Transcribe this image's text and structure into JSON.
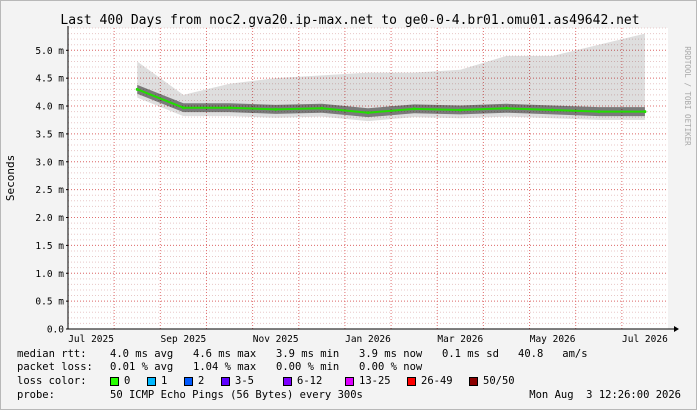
{
  "chart_data": {
    "type": "area",
    "title": "Last 400 Days from noc2.gva20.ip-max.net to ge0-0-4.br01.omu01.as49642.net",
    "ylabel": "Seconds",
    "side_label": "RRDTOOL / TOBI OETIKER",
    "ylim": [
      0,
      5.4
    ],
    "y_ticks": [
      {
        "value": 0.0,
        "label": "0.0"
      },
      {
        "value": 0.5,
        "label": "0.5 m"
      },
      {
        "value": 1.0,
        "label": "1.0 m"
      },
      {
        "value": 1.5,
        "label": "1.5 m"
      },
      {
        "value": 2.0,
        "label": "2.0 m"
      },
      {
        "value": 2.5,
        "label": "2.5 m"
      },
      {
        "value": 3.0,
        "label": "3.0 m"
      },
      {
        "value": 3.5,
        "label": "3.5 m"
      },
      {
        "value": 4.0,
        "label": "4.0 m"
      },
      {
        "value": 4.5,
        "label": "4.5 m"
      },
      {
        "value": 5.0,
        "label": "5.0 m"
      }
    ],
    "x_ticks": [
      "Jul 2025",
      "Sep 2025",
      "Nov 2025",
      "Jan 2026",
      "Mar 2026",
      "May 2026",
      "Jul 2026"
    ],
    "x": [
      "Jul 2025",
      "Aug 2025",
      "Sep 2025",
      "Oct 2025",
      "Nov 2025",
      "Dec 2025",
      "Jan 2026",
      "Feb 2026",
      "Mar 2026",
      "Apr 2026",
      "May 2026",
      "Jun 2026",
      "Jul 2026"
    ],
    "series": [
      {
        "name": "median rtt",
        "values": [
          null,
          4.3,
          3.97,
          3.97,
          3.94,
          3.96,
          3.88,
          3.95,
          3.93,
          3.96,
          3.93,
          3.9,
          3.9
        ]
      },
      {
        "name": "",
        "values": [
          null,
          4.8,
          4.2,
          4.4,
          4.5,
          4.55,
          4.6,
          4.6,
          4.65,
          4.9,
          4.9,
          5.1,
          5.3
        ]
      }
    ]
  },
  "stats": {
    "median_rtt": {
      "label": "median rtt:",
      "avg": "4.0 ms avg",
      "max": "4.6 ms max",
      "min": "3.9 ms min",
      "now": "3.9 ms now",
      "sd": "0.1 ms sd",
      "ams": "40.8   am/s"
    },
    "packet_loss": {
      "label": "packet loss:",
      "avg": "0.01 % avg",
      "max": "1.04 % max",
      "min": "0.00 % min",
      "now": "0.00 % now"
    },
    "loss_color": {
      "label": "loss color:",
      "items": [
        {
          "label": "0",
          "color": "#26ff00"
        },
        {
          "label": "1",
          "color": "#00b8ff"
        },
        {
          "label": "2",
          "color": "#0059ff"
        },
        {
          "label": "3-5",
          "color": "#5e00ff"
        },
        {
          "label": "6-12",
          "color": "#7e00ff"
        },
        {
          "label": "13-25",
          "color": "#dd00ff"
        },
        {
          "label": "26-49",
          "color": "#ff0000"
        },
        {
          "label": "50/50",
          "color": "#8b0000"
        }
      ]
    },
    "probe": {
      "label": "probe:",
      "text": "50 ICMP Echo Pings (56 Bytes) every 300s",
      "timestamp": "Mon Aug  3 12:26:00 2026"
    }
  },
  "colors": {
    "grid_minor": "#e8c8c8",
    "grid_major": "#e07070",
    "median_line": "#22dd00",
    "smoke": "#000000"
  }
}
